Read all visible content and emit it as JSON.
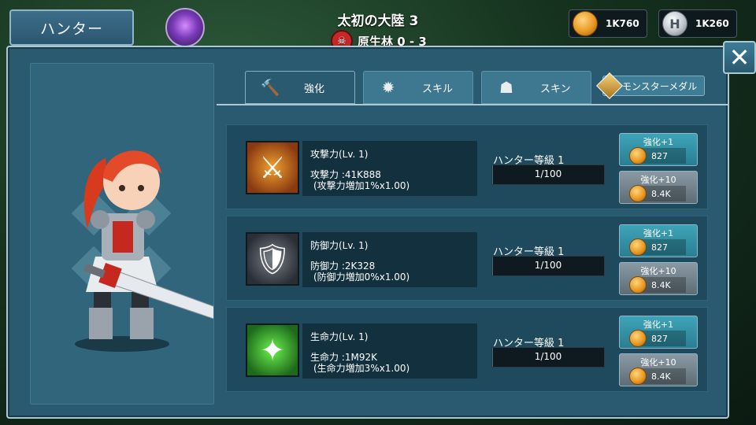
{
  "header": {
    "title_tab": "ハンター",
    "stage_title": "太初の大陸 3",
    "stage_sub": "原生林 0 - 3",
    "region_emblem_icon": "crystal-emblem-icon",
    "danger_icon": "skull-danger-icon"
  },
  "currencies": [
    {
      "icon": "gold-coin-icon",
      "value": "1K760"
    },
    {
      "icon": "hunter-coin-icon",
      "value": "1K260",
      "glyph": "H"
    }
  ],
  "close_label": "✕",
  "tabs": [
    {
      "label": "強化",
      "icon": "hammer-icon",
      "glyph": "🔨",
      "active": true
    },
    {
      "label": "スキル",
      "icon": "burst-icon",
      "glyph": "✹",
      "active": false
    },
    {
      "label": "スキン",
      "icon": "hood-icon",
      "glyph": "☗",
      "active": false
    }
  ],
  "medal_button": {
    "label": "モンスターメダル",
    "icon": "medal-icon"
  },
  "stats": [
    {
      "icon": "crossed-swords-icon",
      "glyph": "⚔",
      "title": "攻撃力(Lv. 1)",
      "value": "攻撃力 :41K888",
      "bonus": "(攻撃力増加1%x1.00)",
      "grade_label": "ハンター等級 1",
      "grade_progress": "1/100",
      "grade_fraction": 0.01,
      "upgrade1_label": "強化+1",
      "upgrade1_cost": "827",
      "upgrade10_label": "強化+10",
      "upgrade10_cost": "8.4K"
    },
    {
      "icon": "armor-icon",
      "glyph": "🛡",
      "title": "防御力(Lv. 1)",
      "value": "防御力 :2K328",
      "bonus": "(防御力増加0%x1.00)",
      "grade_label": "ハンター等級 1",
      "grade_progress": "1/100",
      "grade_fraction": 0.01,
      "upgrade1_label": "強化+1",
      "upgrade1_cost": "827",
      "upgrade10_label": "強化+10",
      "upgrade10_cost": "8.4K"
    },
    {
      "icon": "life-aura-icon",
      "glyph": "✦",
      "title": "生命力(Lv. 1)",
      "value": "生命力 :1M92K",
      "bonus": "(生命力増加3%x1.00)",
      "grade_label": "ハンター等級 1",
      "grade_progress": "1/100",
      "grade_fraction": 0.01,
      "upgrade1_label": "強化+1",
      "upgrade1_cost": "827",
      "upgrade10_label": "強化+10",
      "upgrade10_cost": "8.4K"
    }
  ],
  "colors": {
    "panel": "#2a5a70",
    "primary_button": "#2a7e92",
    "secondary_button": "#5e6c74",
    "attack_icon_bg": "#8a3a10",
    "defense_icon_bg": "#3a3f46",
    "life_icon_bg": "#1e6a1a"
  }
}
